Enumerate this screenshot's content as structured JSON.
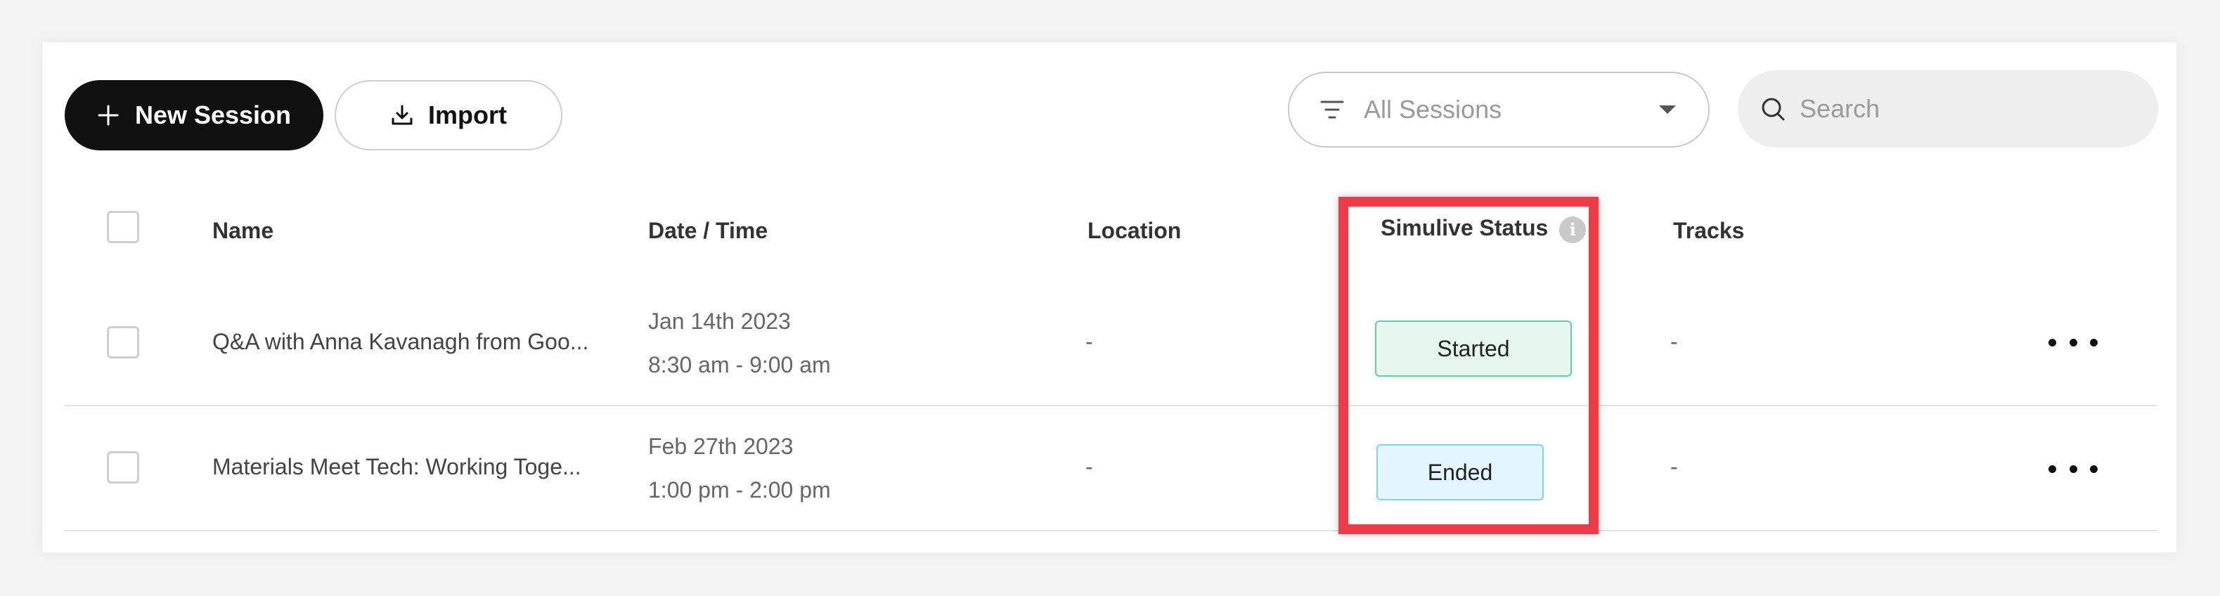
{
  "toolbar": {
    "new_session_label": "New Session",
    "import_label": "Import",
    "filter_value": "All Sessions",
    "search_placeholder": "Search"
  },
  "table": {
    "columns": [
      "Name",
      "Date / Time",
      "Location",
      "Simulive Status",
      "Tracks"
    ],
    "rows": [
      {
        "name": "Q&A with Anna Kavanagh from Goo...",
        "date": "Jan 14th 2023",
        "time": "8:30 am - 9:00 am",
        "location": "-",
        "status": "Started",
        "tracks": "-"
      },
      {
        "name": "Materials Meet Tech: Working Toge...",
        "date": "Feb 27th 2023",
        "time": "1:00 pm - 2:00 pm",
        "location": "-",
        "status": "Ended",
        "tracks": "-"
      }
    ]
  },
  "colors": {
    "highlight": "#ee3b47",
    "started_bg": "#e5f7ef",
    "started_border": "#5fd0a3",
    "ended_bg": "#e4f6fd",
    "ended_border": "#7fd1f0"
  },
  "icons": {
    "new": "plus-icon",
    "import": "download-icon",
    "filter": "filter-icon",
    "dropdown": "caret-down-icon",
    "search": "search-icon",
    "info": "info-icon",
    "row_actions": "more-horizontal-icon"
  }
}
